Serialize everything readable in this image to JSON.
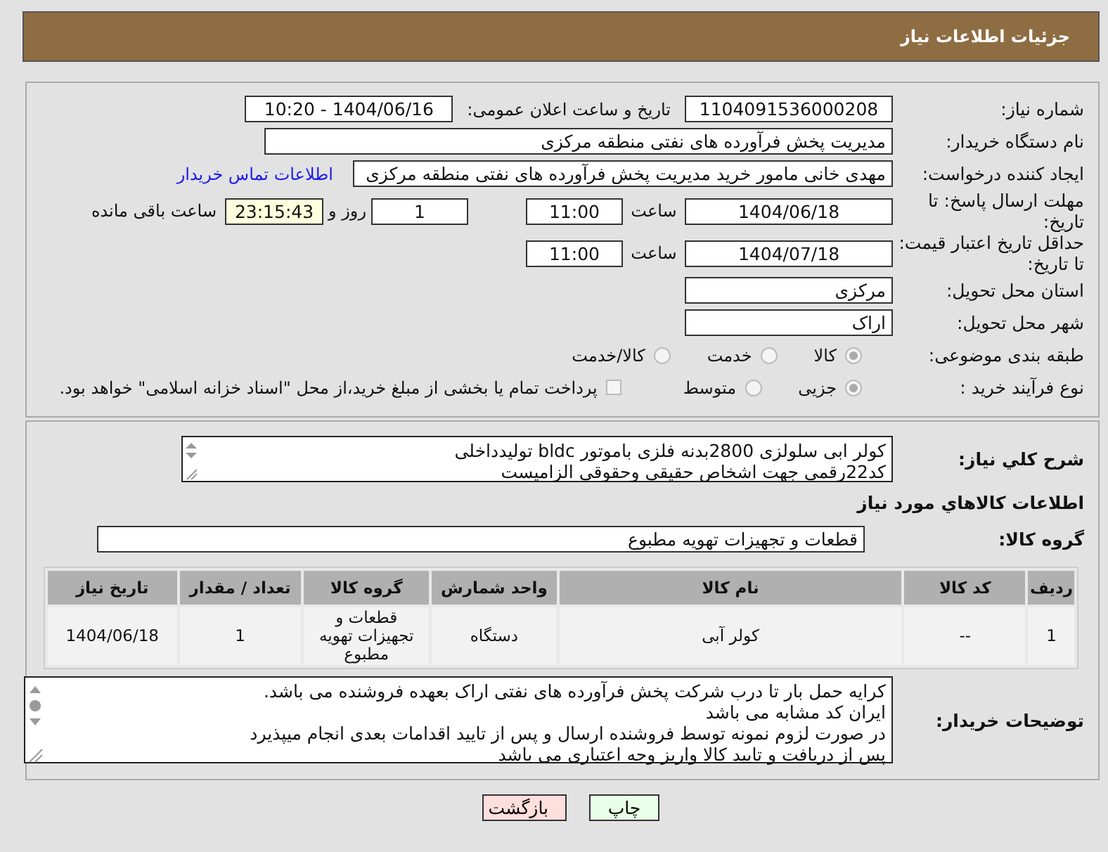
{
  "header": {
    "title": "جزئیات اطلاعات نیاز"
  },
  "need_number": {
    "label": "شماره نیاز:",
    "value": "1104091536000208"
  },
  "announce": {
    "label": "تاریخ و ساعت اعلان عمومی:",
    "value": "1404/06/16 - 10:20"
  },
  "buyer": {
    "label": "نام دستگاه خریدار:",
    "value": "مدیریت پخش فرآورده های نفتی منطقه مرکزی"
  },
  "creator": {
    "label": "ایجاد کننده درخواست:",
    "value": "مهدی خانی مامور خرید مدیریت پخش فرآورده های نفتی منطقه مرکزی",
    "link": "اطلاعات تماس خریدار"
  },
  "deadline": {
    "label": "مهلت ارسال پاسخ: تا تاریخ:",
    "date": "1404/06/18",
    "time_label": "ساعت",
    "time": "11:00",
    "days": "1",
    "days_label": "روز و",
    "remaining": "23:15:43",
    "remaining_label": "ساعت باقی مانده"
  },
  "validity": {
    "label": "حداقل تاریخ اعتبار قیمت: تا تاریخ:",
    "date": "1404/07/18",
    "time_label": "ساعت",
    "time": "11:00"
  },
  "province": {
    "label": "استان محل تحویل:",
    "value": "مرکزی"
  },
  "city": {
    "label": "شهر محل تحویل:",
    "value": "اراک"
  },
  "category": {
    "label": "طبقه بندی موضوعی:",
    "options": [
      {
        "label": "کالا",
        "selected": true
      },
      {
        "label": "خدمت",
        "selected": false
      },
      {
        "label": "کالا/خدمت",
        "selected": false
      }
    ]
  },
  "process": {
    "label": "نوع فرآیند خرید :",
    "options": [
      {
        "label": "جزیی",
        "selected": true
      },
      {
        "label": "متوسط",
        "selected": false
      }
    ],
    "treasury": {
      "label": "پرداخت تمام یا بخشی از مبلغ خرید،از محل \"اسناد خزانه اسلامی\" خواهد بود.",
      "checked": false
    }
  },
  "description": {
    "label": "شرح کلي نياز:",
    "lines": [
      "کولر ابی سلولزی 2800بدنه فلزی باموتور bldc تولیدداخلی",
      "کد22رقمی  جهت اشخاص حقیقی وحقوقی الزامیست"
    ]
  },
  "goods_heading": "اطلاعات كالاهاي مورد نياز",
  "goods_group": {
    "label": "گروه کالا:",
    "value": "قطعات و تجهیزات تهویه مطبوع"
  },
  "table": {
    "columns": [
      "ردیف",
      "کد کالا",
      "نام کالا",
      "واحد شمارش",
      "گروه کالا",
      "تعداد / مقدار",
      "تاریخ نیاز"
    ],
    "rows": [
      [
        "1",
        "--",
        "کولر آبی",
        "دستگاه",
        "قطعات و تجهیزات تهویه مطبوع",
        "1",
        "1404/06/18"
      ]
    ]
  },
  "notes": {
    "label": "توضیحات خریدار:",
    "lines": [
      "کرایه حمل بار تا درب شرکت  پخش فرآورده های نفتی اراک بعهده فروشنده می باشد.",
      "ایران کد مشابه می باشد",
      "در صورت لزوم نمونه توسط فروشنده ارسال و پس از تایید اقدامات بعدی انجام میپذیرد",
      "پس از دریافت و تایید کالا واریز وجه اعتباری می باشد"
    ]
  },
  "buttons": [
    {
      "label": "چاپ",
      "kind": "print"
    },
    {
      "label": "بازگشت",
      "kind": "back"
    }
  ]
}
